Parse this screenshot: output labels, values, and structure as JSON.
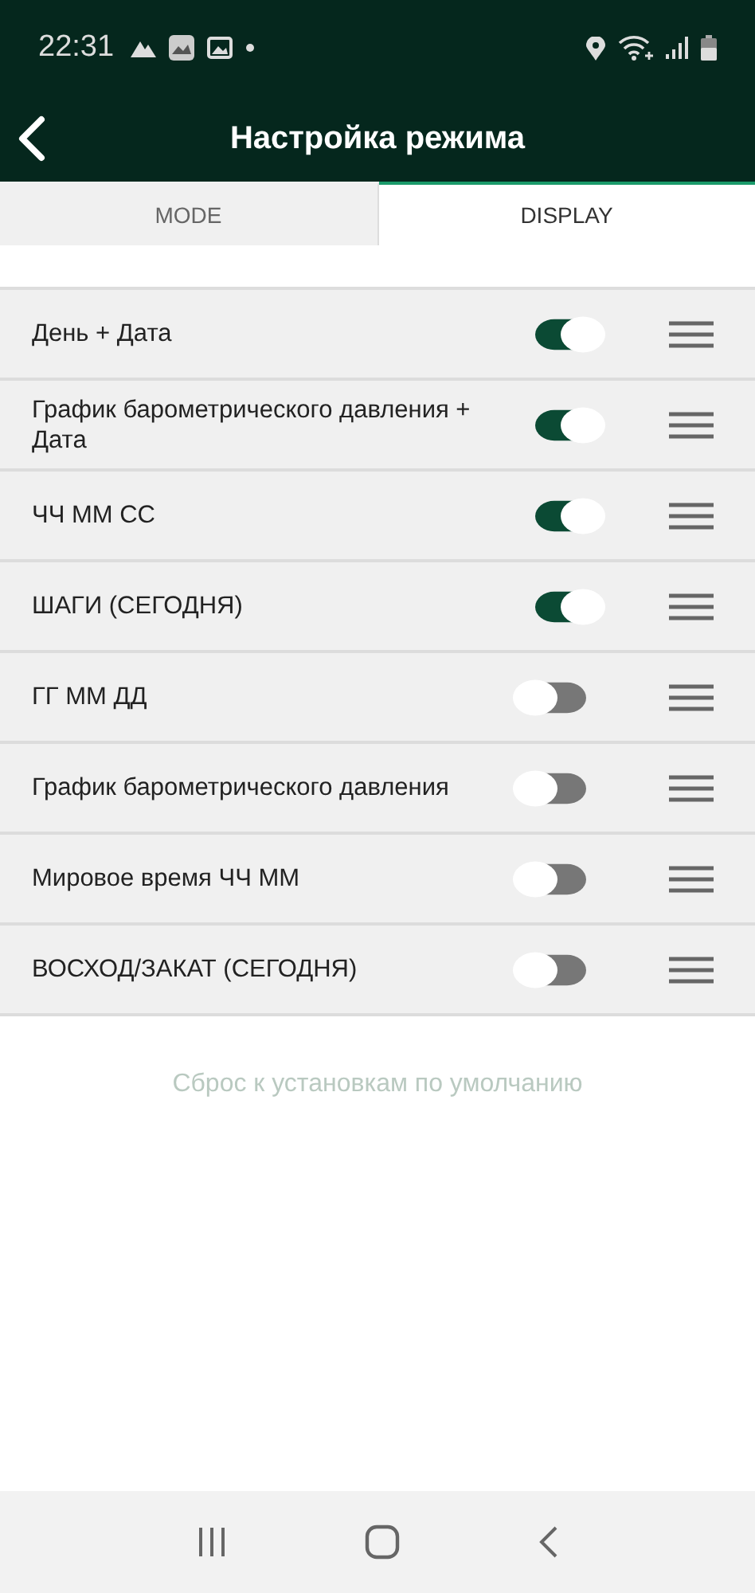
{
  "status_bar": {
    "time": "22:31"
  },
  "header": {
    "title": "Настройка режима"
  },
  "tabs": [
    {
      "label": "MODE",
      "selected": false
    },
    {
      "label": "DISPLAY",
      "selected": true
    }
  ],
  "items": [
    {
      "label": "День + Дата",
      "on": true
    },
    {
      "label": "График барометрического давления + Дата",
      "on": true
    },
    {
      "label": "ЧЧ ММ СС",
      "on": true
    },
    {
      "label": "ШАГИ (СЕГОДНЯ)",
      "on": true
    },
    {
      "label": "ГГ ММ ДД",
      "on": false
    },
    {
      "label": "График барометрического давления",
      "on": false
    },
    {
      "label": "Мировое время ЧЧ ММ",
      "on": false
    },
    {
      "label": "ВОСХОД/ЗАКАТ (СЕГОДНЯ)",
      "on": false
    }
  ],
  "reset_link": "Сброс к установкам по умолчанию"
}
